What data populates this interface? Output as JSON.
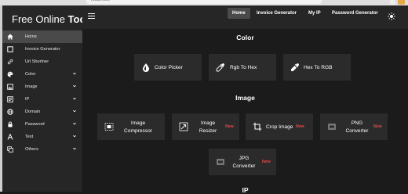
{
  "browser": {
    "url_fragment": "localhost"
  },
  "sidebar": {
    "brand_regular": "Free Online ",
    "brand_bold": "Tool",
    "items": [
      {
        "label": "Home",
        "icon": "home-icon",
        "has_chevron": false,
        "active": true
      },
      {
        "label": "Invoice Generator",
        "icon": "square-icon",
        "has_chevron": false,
        "active": false
      },
      {
        "label": "Url Shortner",
        "icon": "link-icon",
        "has_chevron": false,
        "active": false
      },
      {
        "label": "Color",
        "icon": "palette-icon",
        "has_chevron": true,
        "active": false
      },
      {
        "label": "Image",
        "icon": "image-icon",
        "has_chevron": true,
        "active": false
      },
      {
        "label": "IP",
        "icon": "ip-icon",
        "has_chevron": true,
        "active": false
      },
      {
        "label": "Domain",
        "icon": "globe-icon",
        "has_chevron": true,
        "active": false
      },
      {
        "label": "Password",
        "icon": "lock-icon",
        "has_chevron": true,
        "active": false
      },
      {
        "label": "Text",
        "icon": "text-icon",
        "has_chevron": true,
        "active": false
      },
      {
        "label": "Others",
        "icon": "copy-icon",
        "has_chevron": true,
        "active": false
      }
    ]
  },
  "topnav": {
    "links": [
      "Home",
      "Invoice Generator",
      "My IP",
      "Password Generator"
    ],
    "active": "Home",
    "theme_icon": "sun-icon"
  },
  "sections": {
    "color": {
      "title": "Color",
      "cards": [
        {
          "label": "Color Picker",
          "icon": "drop-icon"
        },
        {
          "label": "Rgb To Hex",
          "icon": "eyedropper-icon"
        },
        {
          "label": "Hex To RGB",
          "icon": "eyedropper-icon"
        }
      ]
    },
    "image": {
      "title": "Image",
      "cards": [
        {
          "line1": "Image",
          "line2": "Compressor",
          "badge": "",
          "icon": "compress-icon"
        },
        {
          "line1": "Image",
          "line2": "Resizer",
          "badge": "New",
          "icon": "resize-icon"
        },
        {
          "line1": "Crop Image",
          "line2": "",
          "badge": "New",
          "icon": "crop-icon"
        },
        {
          "line1": "PNG",
          "line2": "Converter",
          "badge": "New",
          "icon": "png-file-icon"
        },
        {
          "line1": "JPG",
          "line2": "Converter",
          "badge": "New",
          "icon": "jpg-file-icon"
        }
      ]
    },
    "next_title": "IP"
  },
  "colors": {
    "background": "#1b1b1b",
    "panel": "#262626",
    "card": "#2b2b2b",
    "active": "#4a4a4a",
    "badge": "#e64545"
  }
}
